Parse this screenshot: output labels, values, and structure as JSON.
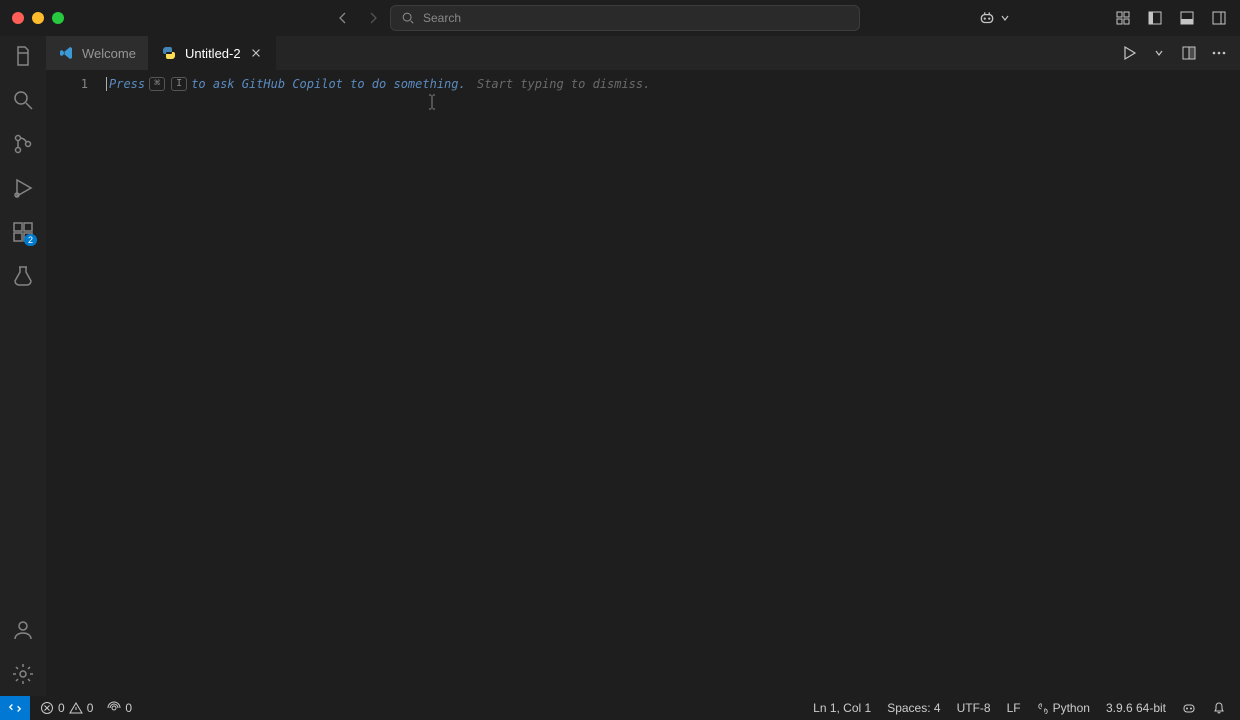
{
  "titlebar": {
    "search_placeholder": "Search"
  },
  "tabs": [
    {
      "label": "Welcome",
      "active": false,
      "icon": "vscode"
    },
    {
      "label": "Untitled-2",
      "active": true,
      "icon": "python"
    }
  ],
  "editor": {
    "line_number": "1",
    "hint_press": "Press",
    "hint_key1": "⌘",
    "hint_key2": "I",
    "hint_rest": "to ask GitHub Copilot to do something.",
    "hint_dismiss": "Start typing to dismiss."
  },
  "activity_bar": {
    "extensions_badge": "2"
  },
  "statusbar": {
    "errors": "0",
    "warnings": "0",
    "ports": "0",
    "cursor_pos": "Ln 1, Col 1",
    "spaces": "Spaces: 4",
    "encoding": "UTF-8",
    "eol": "LF",
    "language": "Python",
    "interpreter": "3.9.6 64-bit"
  }
}
